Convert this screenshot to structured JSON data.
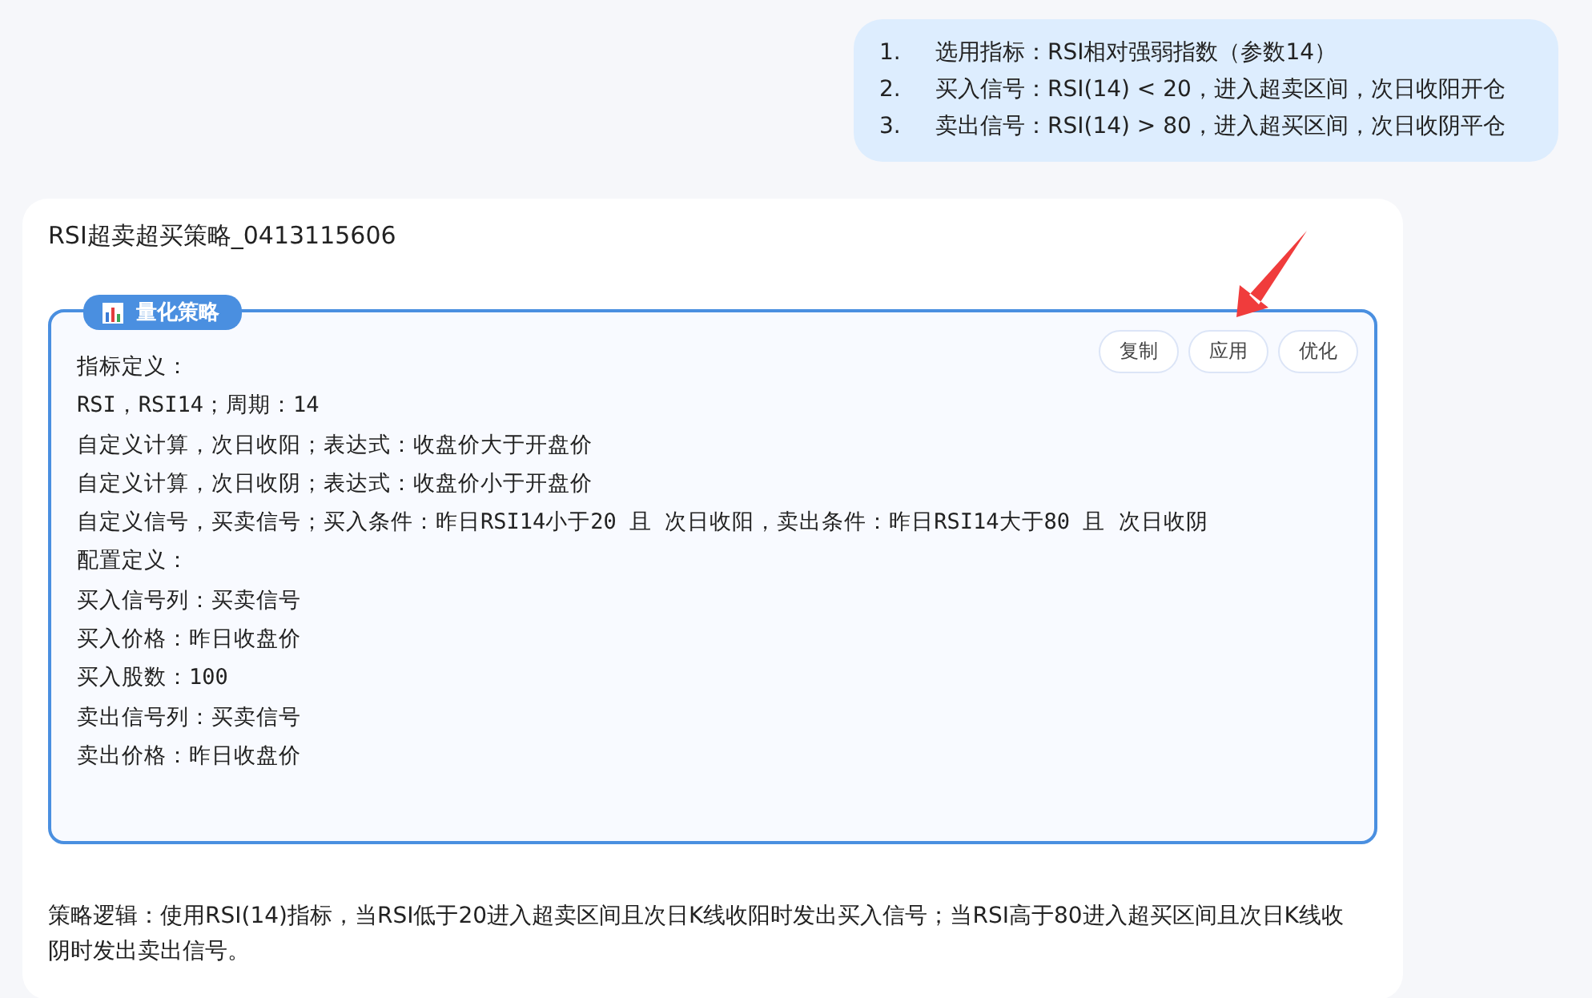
{
  "user_message": {
    "items": [
      {
        "number": "1.",
        "text": "选用指标：RSI相对强弱指数（参数14）"
      },
      {
        "number": "2.",
        "text": "买入信号：RSI(14) < 20，进入超卖区间，次日收阳开仓"
      },
      {
        "number": "3.",
        "text": "卖出信号：RSI(14) > 80，进入超买区间，次日收阴平仓"
      }
    ]
  },
  "reply": {
    "title": "RSI超卖超买策略_0413115606",
    "strategy_block": {
      "badge": "量化策略",
      "buttons": [
        "复制",
        "应用",
        "优化"
      ],
      "lines": [
        "指标定义：",
        "RSI，RSI14；周期：14",
        "自定义计算，次日收阳；表达式：收盘价大于开盘价",
        "自定义计算，次日收阴；表达式：收盘价小于开盘价",
        "自定义信号，买卖信号；买入条件：昨日RSI14小于20 且 次日收阳，卖出条件：昨日RSI14大于80 且 次日收阴",
        "配置定义：",
        "买入信号列：买卖信号",
        "买入价格：昨日收盘价",
        "买入股数：100",
        "卖出信号列：买卖信号",
        "卖出价格：昨日收盘价"
      ]
    },
    "logic": "策略逻辑：使用RSI(14)指标，当RSI低于20进入超卖区间且次日K线收阳时发出买入信号；当RSI高于80进入超买区间且次日K线收阴时发出卖出信号。"
  }
}
